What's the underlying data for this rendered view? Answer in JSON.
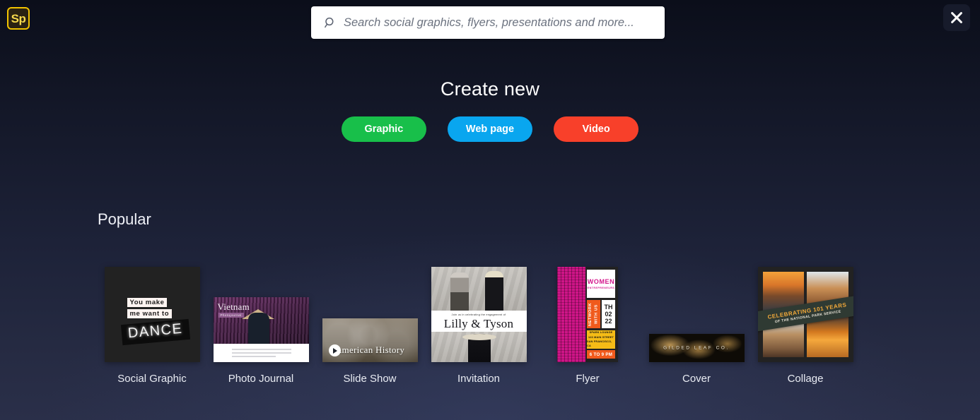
{
  "app": {
    "logo_text": "Sp",
    "logo_border_color": "#f2c300"
  },
  "search": {
    "placeholder": "Search social graphics, flyers, presentations and more...",
    "value": "",
    "icon": "search-icon"
  },
  "close": {
    "icon": "close-icon",
    "label": "Close"
  },
  "create": {
    "title": "Create new",
    "buttons": [
      {
        "label": "Graphic",
        "color": "#18bf4a"
      },
      {
        "label": "Web page",
        "color": "#09a6ef"
      },
      {
        "label": "Video",
        "color": "#f8402a"
      }
    ]
  },
  "popular": {
    "title": "Popular",
    "cards": [
      {
        "label": "Social Graphic",
        "art": {
          "bg": "#e8c5bd",
          "line1": "You make",
          "line2": "me want to",
          "headline": "DANCE"
        }
      },
      {
        "label": "Photo Journal",
        "art": {
          "title": "Vietnam",
          "subtitle": "Photojournal"
        }
      },
      {
        "label": "Slide Show",
        "art": {
          "title": "American History",
          "play": "play-icon"
        }
      },
      {
        "label": "Invitation",
        "art": {
          "kicker": "Join us in celebrating the engagement of",
          "names": "Lilly & Tyson"
        }
      },
      {
        "label": "Flyer",
        "art": {
          "heading": "WOMEN",
          "subheading": "ENTREPRENEURS",
          "vertical": "NETWORK WITH US",
          "day": "TH",
          "month": "02",
          "year": "22",
          "venue": "SPARK LOUNGE",
          "street": "123 MAIN STREET",
          "city": "SAN FRANCISCO, CA",
          "hours": "6 TO 9 PM"
        }
      },
      {
        "label": "Cover",
        "art": {
          "title": "GILDED LEAF CO."
        }
      },
      {
        "label": "Collage",
        "art": {
          "banner_line1": "CELEBRATING 101 YEARS",
          "banner_line2": "OF THE NATIONAL PARK SERVICE"
        }
      }
    ]
  }
}
